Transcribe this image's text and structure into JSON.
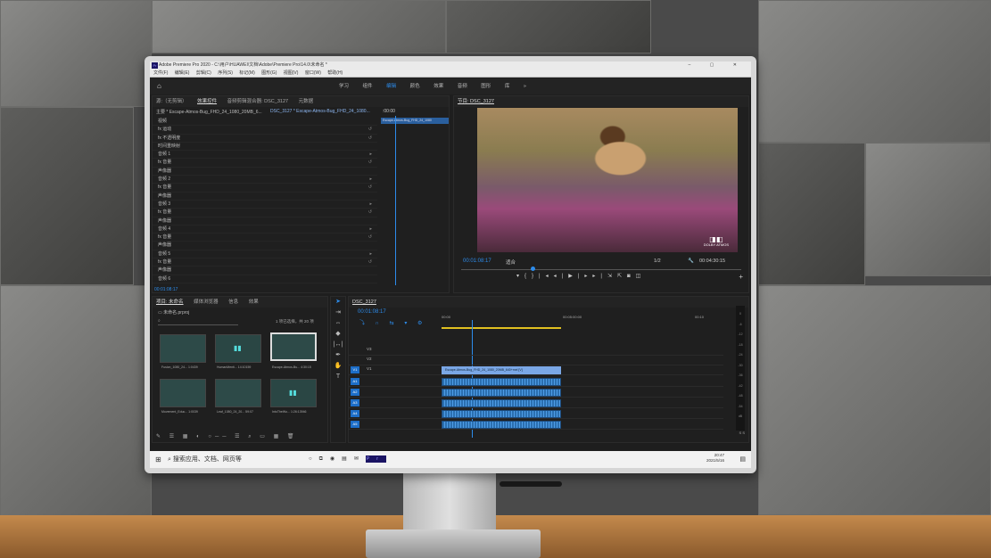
{
  "app": {
    "title": "Adobe Premiere Pro 2020 - C:\\用户\\HUAWEI\\文档\\Adobe\\Premiere Pro\\14.0\\未命名 *",
    "menu": [
      "文件(F)",
      "编辑(E)",
      "剪辑(C)",
      "序列(S)",
      "标记(M)",
      "图形(G)",
      "视图(V)",
      "窗口(W)",
      "帮助(H)"
    ],
    "workspaces": [
      "学习",
      "组件",
      "编辑",
      "颜色",
      "效果",
      "音频",
      "图形",
      "库"
    ],
    "active_workspace": "编辑"
  },
  "effect_controls": {
    "tabs": [
      "源:（无剪辑）",
      "效果控件",
      "音频剪辑混合器: DSC_3127",
      "元数据"
    ],
    "source": "主要 * Escape-Atmos-Bug_FHD_24_1080_20MB_6...",
    "sequence": "DSC_3127 * Escape-Atmos-Bug_FHD_24_1080...",
    "timecode": ":00:00",
    "clip_name": "Escape-Atmos-Bug_FHD_24_1080",
    "rows": [
      {
        "label": "视频",
        "icon": ""
      },
      {
        "label": "运动",
        "icon": "fx"
      },
      {
        "label": "不透明度",
        "icon": "fx"
      },
      {
        "label": "时间重映射",
        "icon": ""
      },
      {
        "label": "音频 1",
        "icon": ""
      },
      {
        "label": "音量",
        "icon": "fx"
      },
      {
        "label": "声像器",
        "icon": ""
      },
      {
        "label": "音频 2",
        "icon": ""
      },
      {
        "label": "音量",
        "icon": "fx"
      },
      {
        "label": "声像器",
        "icon": ""
      },
      {
        "label": "音频 3",
        "icon": ""
      },
      {
        "label": "音量",
        "icon": "fx"
      },
      {
        "label": "声像器",
        "icon": ""
      },
      {
        "label": "音频 4",
        "icon": ""
      },
      {
        "label": "音量",
        "icon": "fx"
      },
      {
        "label": "声像器",
        "icon": ""
      },
      {
        "label": "音频 5",
        "icon": ""
      },
      {
        "label": "音量",
        "icon": "fx"
      },
      {
        "label": "声像器",
        "icon": ""
      },
      {
        "label": "音频 6",
        "icon": ""
      }
    ],
    "footer_timecode": "00:01:08:17"
  },
  "program_monitor": {
    "title": "节目: DSC_3127",
    "timecode": "00:01:08:17",
    "fit": "适合",
    "resolution": "1/2",
    "duration": "00:04:30:15",
    "dolby": "DOLBY ATMOS"
  },
  "project": {
    "tabs": [
      "项目: 未命名",
      "媒体浏览器",
      "信息",
      "效果"
    ],
    "file": "未命名.prproj",
    "selection": "1 项已选择，共 20 项",
    "items": [
      {
        "name": "Fusion_1080_24...",
        "dur": "1:0439"
      },
      {
        "name": "HumanMenti...",
        "dur": "14:10159"
      },
      {
        "name": "Escape-Atmos-Bu...",
        "dur": "4:30:15"
      },
      {
        "name": "Movement_Educ...",
        "dur": "1:0039"
      },
      {
        "name": "Leaf_1080_24_20...",
        "dur": "59:07"
      },
      {
        "name": "IntoTheWo...",
        "dur": "1:26:13946"
      }
    ]
  },
  "timeline": {
    "tab": "DSC_3127",
    "timecode": "00:01:08:17",
    "ruler": [
      "00:00",
      "00:05:00:00",
      "00:10"
    ],
    "video_tracks": [
      "V3",
      "V2",
      "V1"
    ],
    "audio_tracks": [
      "A1",
      "A2",
      "A3",
      "A4",
      "A5"
    ],
    "clip_label": "Escape-Atmos-Bug_FHD_24_1080_20MB_640+mel [V]",
    "meter_scale": [
      "0",
      "-6",
      "-12",
      "-18",
      "-24",
      "-30",
      "-36",
      "-42",
      "-48",
      "-54",
      "dB"
    ],
    "meter_footer": "S S"
  },
  "taskbar": {
    "search": "搜索应用、文档、网页等",
    "time": "20:47",
    "date": "2021/5/16"
  }
}
